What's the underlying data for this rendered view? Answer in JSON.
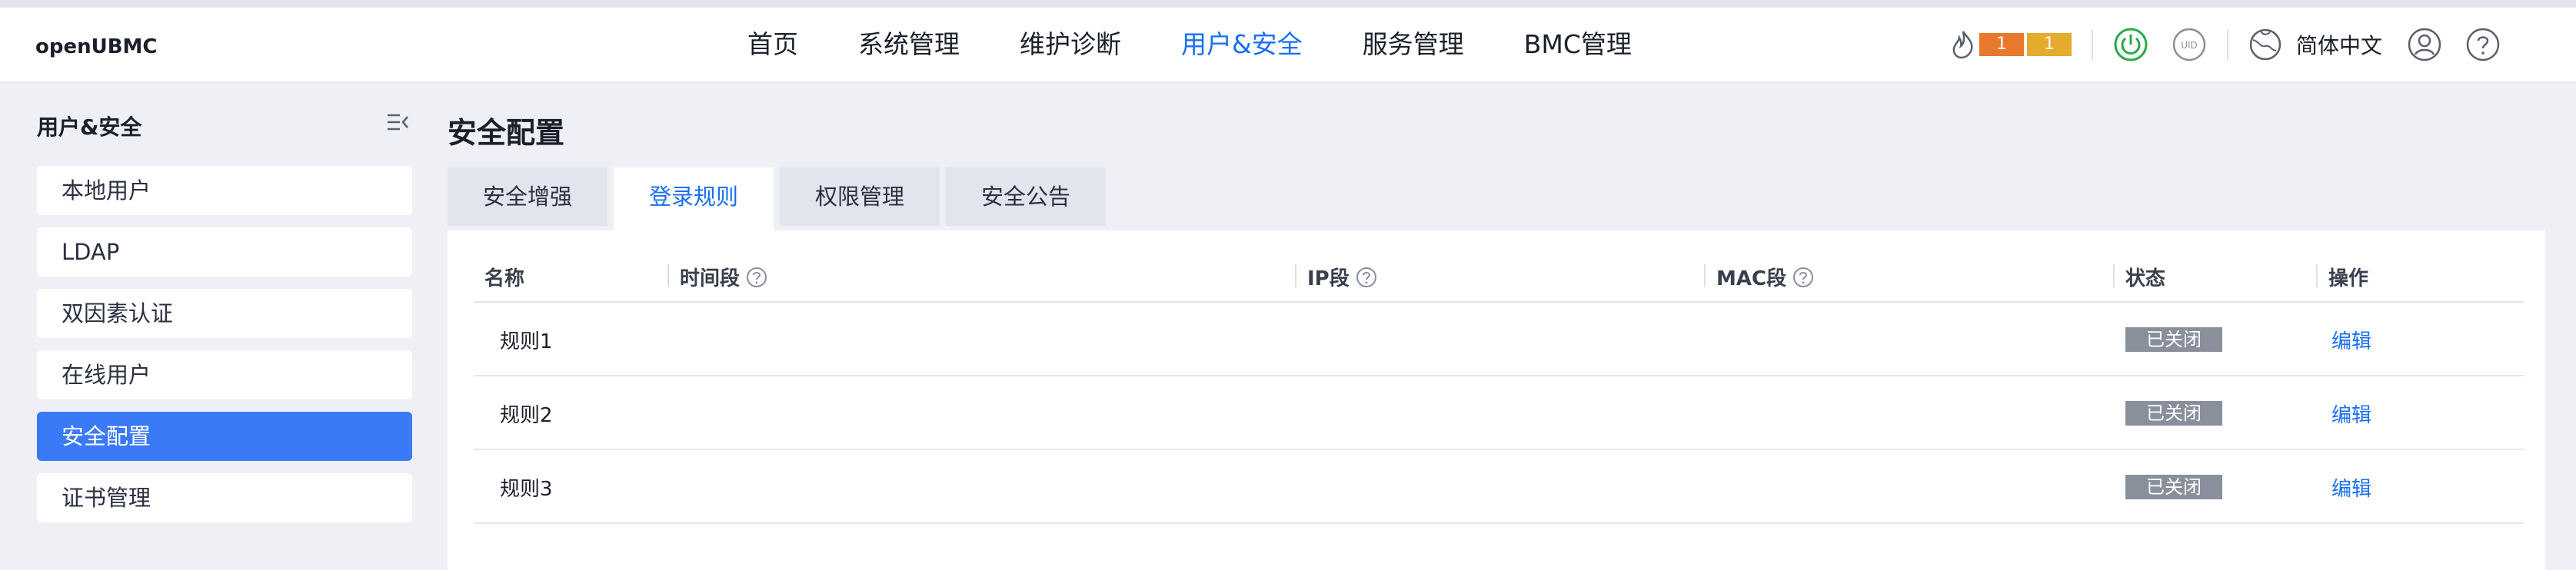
{
  "header": {
    "brand": "openUBMC",
    "nav": [
      {
        "label": "首页"
      },
      {
        "label": "系统管理"
      },
      {
        "label": "维护诊断"
      },
      {
        "label": "用户&安全"
      },
      {
        "label": "服务管理"
      },
      {
        "label": "BMC管理"
      }
    ],
    "active_nav": "用户&安全",
    "alarm_major_count": "1",
    "alarm_minor_count": "1",
    "language": "简体中文",
    "icons": [
      "fire-alarm-icon",
      "power-icon",
      "uid-icon",
      "globe-icon",
      "user-icon",
      "help-icon"
    ]
  },
  "sidebar": {
    "title": "用户&安全",
    "items": [
      {
        "label": "本地用户"
      },
      {
        "label": "LDAP"
      },
      {
        "label": "双因素认证"
      },
      {
        "label": "在线用户"
      },
      {
        "label": "安全配置"
      },
      {
        "label": "证书管理"
      }
    ],
    "active_item": "安全配置"
  },
  "main": {
    "title": "安全配置",
    "tabs": [
      {
        "label": "安全增强"
      },
      {
        "label": "登录规则"
      },
      {
        "label": "权限管理"
      },
      {
        "label": "安全公告"
      }
    ],
    "active_tab": "登录规则",
    "table": {
      "columns": [
        "名称",
        "时间段",
        "IP段",
        "MAC段",
        "状态",
        "操作"
      ],
      "rows": [
        {
          "name": "规则1",
          "time": "",
          "ip": "",
          "mac": "",
          "status": "已关闭",
          "action": "编辑"
        },
        {
          "name": "规则2",
          "time": "",
          "ip": "",
          "mac": "",
          "status": "已关闭",
          "action": "编辑"
        },
        {
          "name": "规则3",
          "time": "",
          "ip": "",
          "mac": "",
          "status": "已关闭",
          "action": "编辑"
        }
      ]
    }
  },
  "colors": {
    "accent": "#1a6ef3",
    "sidebar_active": "#3b7af7",
    "alarm_major": "#e8792c",
    "alarm_minor": "#e4ab2c",
    "power_green": "#2aa84a",
    "status_off": "#8a8f9c"
  }
}
